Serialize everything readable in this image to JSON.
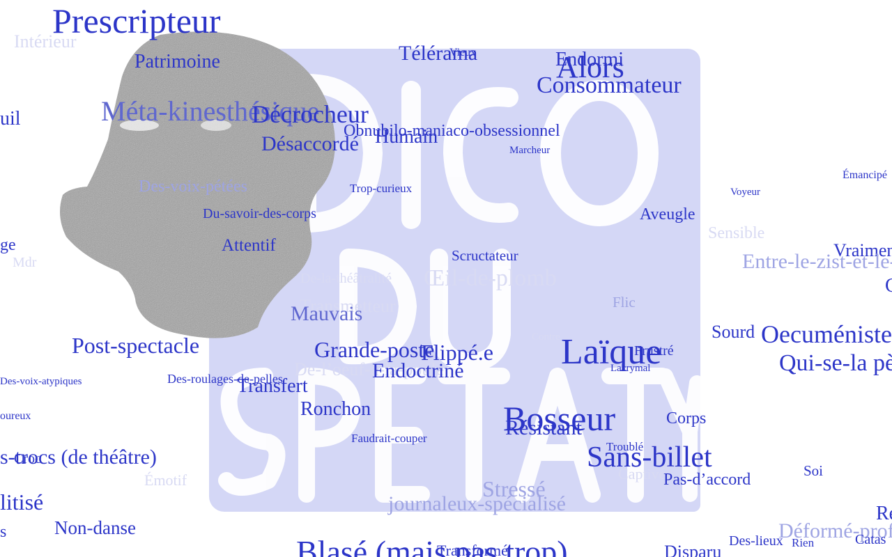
{
  "colors": {
    "strong": "#2c35c8",
    "mid": "#5f67cf",
    "faint": "#9ea4e3",
    "ghost": "#d8daf3",
    "logo_bg": "#d4d7f6",
    "head": "#9c9c9c"
  },
  "logo": {
    "lettering": "Le Dico du Spectateur",
    "icon": "dico-logo-icon"
  },
  "portrait": {
    "icon": "head-profile-icon"
  },
  "words": [
    {
      "id": "prescripteur",
      "text": "Prescripteur",
      "tone": "strong"
    },
    {
      "id": "interieur",
      "text": "Intérieur",
      "tone": "ghost"
    },
    {
      "id": "patrimoine",
      "text": "Patrimoine",
      "tone": "strong"
    },
    {
      "id": "telerama",
      "text": "Télérama",
      "tone": "strong"
    },
    {
      "id": "vieux",
      "text": "Vieux",
      "tone": "strong"
    },
    {
      "id": "endormi",
      "text": "Endormi",
      "tone": "strong"
    },
    {
      "id": "alors",
      "text": "Alors",
      "tone": "strong"
    },
    {
      "id": "consommateur",
      "text": "Consommateur",
      "tone": "strong"
    },
    {
      "id": "uil",
      "text": "uil",
      "tone": "strong"
    },
    {
      "id": "meta-kinesthesique",
      "text": "Méta-kinesthésique",
      "tone": "mid"
    },
    {
      "id": "decrocheur",
      "text": "Décrocheur",
      "tone": "strong"
    },
    {
      "id": "obnubilo",
      "text": "Obnubilo-maniaco-obsessionnel",
      "tone": "strong"
    },
    {
      "id": "humain",
      "text": "Humain",
      "tone": "strong"
    },
    {
      "id": "desaccorde",
      "text": "Désaccordé",
      "tone": "strong"
    },
    {
      "id": "marcheur",
      "text": "Marcheur",
      "tone": "strong"
    },
    {
      "id": "emancipe",
      "text": "Émancipé",
      "tone": "strong"
    },
    {
      "id": "des-voix-petees",
      "text": "Des-voix-pétées",
      "tone": "faint"
    },
    {
      "id": "trop-curieux",
      "text": "Trop-curieux",
      "tone": "strong"
    },
    {
      "id": "voyeur",
      "text": "Voyeur",
      "tone": "strong"
    },
    {
      "id": "du-savoir",
      "text": "Du-savoir-des-corps",
      "tone": "strong"
    },
    {
      "id": "aveugle",
      "text": "Aveugle",
      "tone": "strong"
    },
    {
      "id": "sensible",
      "text": "Sensible",
      "tone": "ghost"
    },
    {
      "id": "ge",
      "text": "ge",
      "tone": "strong"
    },
    {
      "id": "mdr",
      "text": "Mdr",
      "tone": "ghost"
    },
    {
      "id": "attentif",
      "text": "Attentif",
      "tone": "strong"
    },
    {
      "id": "vraiment",
      "text": "Vraiment",
      "tone": "strong"
    },
    {
      "id": "scructateur",
      "text": "Scructateur",
      "tone": "strong"
    },
    {
      "id": "entre-le-zist",
      "text": "Entre-le-zist-et-le-zest",
      "tone": "faint"
    },
    {
      "id": "de-la-theatralite",
      "text": "De-la-théâtralité",
      "tone": "ghost"
    },
    {
      "id": "oeil-de-plomb",
      "text": "Œil-de-plomb",
      "tone": "ghost"
    },
    {
      "id": "c-edge",
      "text": "C",
      "tone": "strong"
    },
    {
      "id": "transmetteur",
      "text": "Transmetteur",
      "tone": "ghost"
    },
    {
      "id": "flic",
      "text": "Flic",
      "tone": "faint"
    },
    {
      "id": "mauvais",
      "text": "Mauvais",
      "tone": "mid"
    },
    {
      "id": "sourd",
      "text": "Sourd",
      "tone": "strong"
    },
    {
      "id": "oecumeniste",
      "text": "Oecuméniste",
      "tone": "strong"
    },
    {
      "id": "contre",
      "text": "Contre",
      "tone": "ghost"
    },
    {
      "id": "post-spectacle",
      "text": "Post-spectacle",
      "tone": "strong"
    },
    {
      "id": "grande-poste",
      "text": "Grande-poste",
      "tone": "strong"
    },
    {
      "id": "flippe",
      "text": "Flippé.e",
      "tone": "strong"
    },
    {
      "id": "laique",
      "text": "Laïque",
      "tone": "strong"
    },
    {
      "id": "frustre",
      "text": "Frustré",
      "tone": "strong"
    },
    {
      "id": "lacrymal",
      "text": "Lacrymal",
      "tone": "strong"
    },
    {
      "id": "qui-se-la",
      "text": "Qui-se-la pète",
      "tone": "strong"
    },
    {
      "id": "de-l-oeuf",
      "text": "De-l’oeuf-à-la-poule",
      "tone": "ghost"
    },
    {
      "id": "endoctrine",
      "text": "Endoctriné",
      "tone": "strong"
    },
    {
      "id": "voix-atypiques",
      "text": "Des-voix-atypiques",
      "tone": "strong"
    },
    {
      "id": "roulages",
      "text": "Des-roulages-de-pelles",
      "tone": "strong"
    },
    {
      "id": "transfert",
      "text": "Transfert",
      "tone": "strong"
    },
    {
      "id": "oureux",
      "text": "oureux",
      "tone": "strong"
    },
    {
      "id": "ronchon",
      "text": "Ronchon",
      "tone": "strong"
    },
    {
      "id": "bosseur",
      "text": "Bosseur",
      "tone": "strong"
    },
    {
      "id": "resistant",
      "text": "Résistant",
      "tone": "strong"
    },
    {
      "id": "corps",
      "text": "Corps",
      "tone": "strong"
    },
    {
      "id": "faudrait-couper",
      "text": "Faudrait-couper",
      "tone": "strong"
    },
    {
      "id": "trouble",
      "text": "Troublé",
      "tone": "strong"
    },
    {
      "id": "croc",
      "text": "Croc",
      "tone": "strong"
    },
    {
      "id": "trocs",
      "text": "s-trocs (de théâtre)",
      "tone": "strong"
    },
    {
      "id": "sans-billet",
      "text": "Sans-billet",
      "tone": "strong"
    },
    {
      "id": "soi",
      "text": "Soi",
      "tone": "strong"
    },
    {
      "id": "captive",
      "text": "Captivé",
      "tone": "ghost"
    },
    {
      "id": "emotif",
      "text": "Émotif",
      "tone": "ghost"
    },
    {
      "id": "pas-d-accord",
      "text": "Pas-d’accord",
      "tone": "strong"
    },
    {
      "id": "stresse",
      "text": "Stressé",
      "tone": "faint"
    },
    {
      "id": "litise",
      "text": "litisé",
      "tone": "strong"
    },
    {
      "id": "journaleux",
      "text": "journaleux-spécialisé",
      "tone": "faint"
    },
    {
      "id": "re-edge",
      "text": "Re",
      "tone": "strong"
    },
    {
      "id": "non-danse",
      "text": "Non-danse",
      "tone": "strong"
    },
    {
      "id": "deforme",
      "text": "Déformé-professionnel",
      "tone": "faint"
    },
    {
      "id": "s-edge",
      "text": "s",
      "tone": "strong"
    },
    {
      "id": "des-lieux",
      "text": "Des-lieux",
      "tone": "strong"
    },
    {
      "id": "rien",
      "text": "Rien",
      "tone": "strong"
    },
    {
      "id": "catas",
      "text": "Catas",
      "tone": "strong"
    },
    {
      "id": "blase",
      "text": "Blasé (mais pas trop)",
      "tone": "strong"
    },
    {
      "id": "transforme",
      "text": "Transformé",
      "tone": "strong"
    },
    {
      "id": "disparu",
      "text": "Disparu",
      "tone": "strong"
    }
  ]
}
